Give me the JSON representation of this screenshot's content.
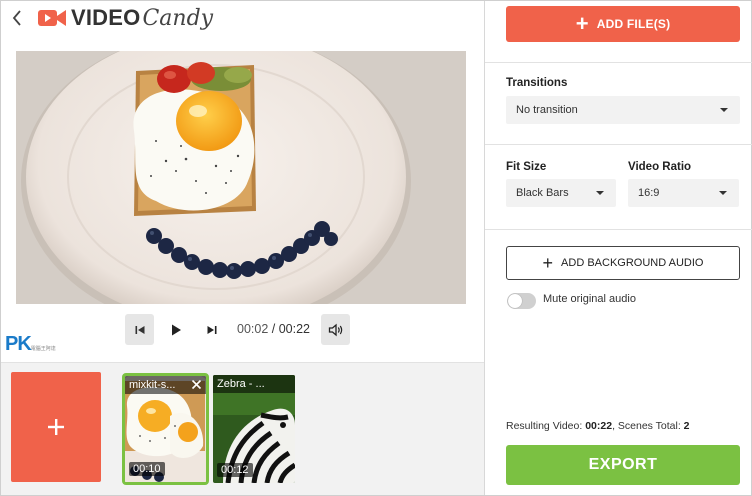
{
  "brand": {
    "word1": "VIDEO",
    "word2": "Candy",
    "accent": "#f0624a"
  },
  "player": {
    "current_time": "00:02",
    "separator": " / ",
    "total_time": "00:22",
    "icons": [
      "skip-back-icon",
      "play-icon",
      "skip-forward-icon",
      "volume-icon"
    ]
  },
  "watermark": {
    "text": "PK",
    "small": "電腦王阿達"
  },
  "timeline": {
    "clips": [
      {
        "title": "mixkit-s...",
        "duration": "00:10",
        "selected": true
      },
      {
        "title": "Zebra - ...",
        "duration": "00:12",
        "selected": false
      }
    ]
  },
  "sidebar": {
    "add_files_label": "ADD FILE(S)",
    "transitions_label": "Transitions",
    "transition_value": "No transition",
    "fit_size_label": "Fit Size",
    "fit_size_value": "Black Bars",
    "video_ratio_label": "Video Ratio",
    "video_ratio_value": "16:9",
    "bg_audio_label": "ADD BACKGROUND AUDIO",
    "mute_label": "Mute original audio",
    "mute_on": false,
    "result_prefix": "Resulting Video: ",
    "result_duration": "00:22",
    "result_mid": ", Scenes Total: ",
    "result_scenes": "2",
    "export_label": "EXPORT",
    "export_color": "#7bc142"
  }
}
